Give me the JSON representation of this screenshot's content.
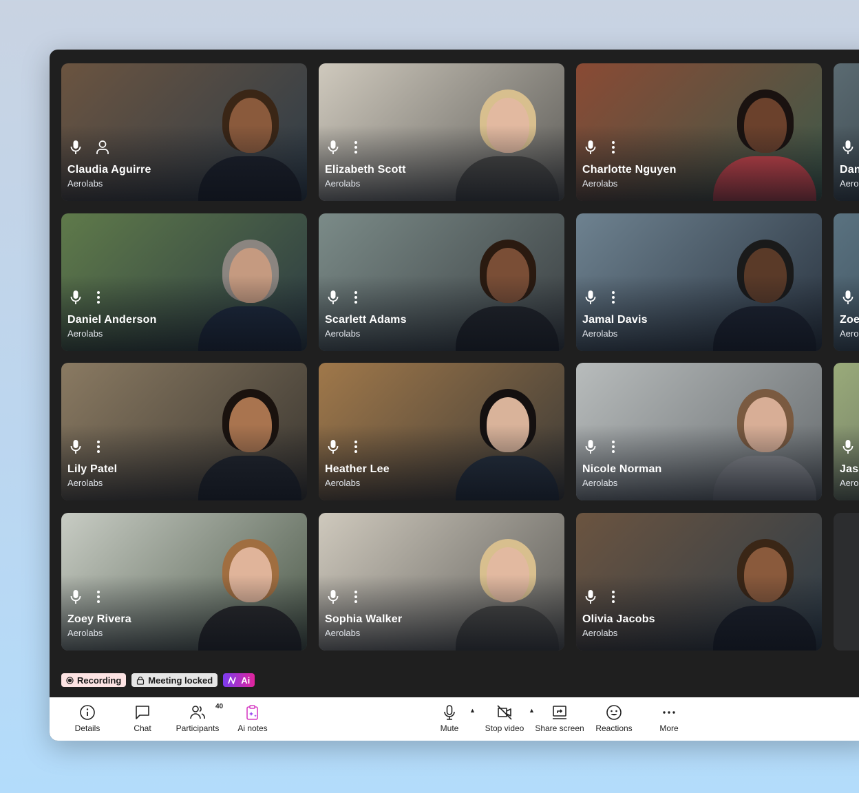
{
  "participants": [
    {
      "name": "Claudia Aguirre",
      "org": "Aerolabs",
      "secondary_icon": "person-icon",
      "bg": [
        "#6b5440",
        "#2d3c48"
      ],
      "hair": "#3a2616",
      "skin": "#8a5a3c",
      "suit": "#1d212b"
    },
    {
      "name": "Elizabeth Scott",
      "org": "Aerolabs",
      "secondary_icon": "more-vertical-icon",
      "bg": [
        "#cfc9bd",
        "#5d5c58"
      ],
      "hair": "#d8bf8e",
      "skin": "#e2b9a0",
      "suit": "#4b4a47"
    },
    {
      "name": "Charlotte Nguyen",
      "org": "Aerolabs",
      "secondary_icon": "more-vertical-icon",
      "bg": [
        "#8a4a34",
        "#3c5a4a"
      ],
      "hair": "#1a1210",
      "skin": "#6b412c",
      "suit": "#d8494f"
    },
    {
      "name": "Dan",
      "org": "Aerolabs",
      "secondary_icon": "",
      "bg": [
        "#5b6b72",
        "#20282f"
      ],
      "hair": "#333",
      "skin": "#a9836b",
      "suit": "#1c2230"
    },
    {
      "name": "Daniel Anderson",
      "org": "Aerolabs",
      "secondary_icon": "more-vertical-icon",
      "bg": [
        "#5f7a4a",
        "#2b3a42"
      ],
      "hair": "#8b8580",
      "skin": "#c59a80",
      "suit": "#1e2a3e"
    },
    {
      "name": "Scarlett Adams",
      "org": "Aerolabs",
      "secondary_icon": "more-vertical-icon",
      "bg": [
        "#7b8b88",
        "#3a3f42"
      ],
      "hair": "#2a1a10",
      "skin": "#7a4e36",
      "suit": "#22252b"
    },
    {
      "name": "Jamal Davis",
      "org": "Aerolabs",
      "secondary_icon": "more-vertical-icon",
      "bg": [
        "#6e8290",
        "#2a3440"
      ],
      "hair": "#1a1a1a",
      "skin": "#5a3a28",
      "suit": "#1e2432"
    },
    {
      "name": "Zoe",
      "org": "Aerolabs",
      "secondary_icon": "",
      "bg": [
        "#5a7280",
        "#2a3844"
      ],
      "hair": "#333",
      "skin": "#a9836b",
      "suit": "#1c2230"
    },
    {
      "name": "Lily Patel",
      "org": "Aerolabs",
      "secondary_icon": "more-vertical-icon",
      "bg": [
        "#8a7a62",
        "#3a3630"
      ],
      "hair": "#1a120e",
      "skin": "#a9744f",
      "suit": "#22262e"
    },
    {
      "name": "Heather Lee",
      "org": "Aerolabs",
      "secondary_icon": "more-vertical-icon",
      "bg": [
        "#a0784a",
        "#3c3a36"
      ],
      "hair": "#141010",
      "skin": "#d9b39a",
      "suit": "#26303e"
    },
    {
      "name": "Nicole Norman",
      "org": "Aerolabs",
      "secondary_icon": "more-vertical-icon",
      "bg": [
        "#b8bcbc",
        "#666b6e"
      ],
      "hair": "#7a5a40",
      "skin": "#d8ae96",
      "suit": "#8d8f94"
    },
    {
      "name": "Jas",
      "org": "Aerolabs",
      "secondary_icon": "",
      "bg": [
        "#9aab7a",
        "#4a4f52"
      ],
      "hair": "#333",
      "skin": "#a9836b",
      "suit": "#1c2230"
    },
    {
      "name": "Zoey Rivera",
      "org": "Aerolabs",
      "secondary_icon": "more-vertical-icon",
      "bg": [
        "#c8ccc4",
        "#4d5a4a"
      ],
      "hair": "#a06e40",
      "skin": "#e0b49a",
      "suit": "#2a2a2c"
    },
    {
      "name": "Sophia Walker",
      "org": "Aerolabs",
      "secondary_icon": "more-vertical-icon",
      "bg": [
        "#cfc9bd",
        "#5d5c58"
      ],
      "hair": "#d8bf8e",
      "skin": "#e2b9a0",
      "suit": "#4b4a47"
    },
    {
      "name": "Olivia Jacobs",
      "org": "Aerolabs",
      "secondary_icon": "more-vertical-icon",
      "bg": [
        "#6b5440",
        "#2d3c48"
      ],
      "hair": "#3a2616",
      "skin": "#8a5a3c",
      "suit": "#1d212b"
    }
  ],
  "badges": {
    "recording": "Recording",
    "locked": "Meeting locked",
    "ai": "Ai"
  },
  "toolbar": {
    "details": "Details",
    "chat": "Chat",
    "participants": "Participants",
    "participants_count": "40",
    "ai_notes": "Ai notes",
    "mute": "Mute",
    "stop_video": "Stop video",
    "share_screen": "Share screen",
    "reactions": "Reactions",
    "more": "More"
  },
  "colors": {
    "ai_accent": "#d63fc4",
    "recording_bg": "#fde3e3"
  }
}
